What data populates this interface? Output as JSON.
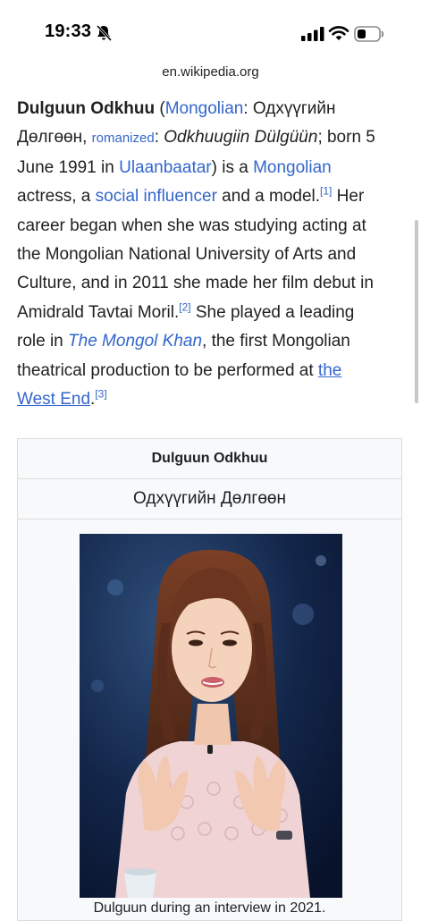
{
  "status_bar": {
    "time": "19:33",
    "icons": [
      "bell-slash-icon",
      "cellular-signal-icon",
      "wifi-icon",
      "battery-icon"
    ]
  },
  "browser": {
    "url": "en.wikipedia.org"
  },
  "article": {
    "subject": "Dulguun Odkhuu",
    "t1": " (",
    "link_mongolian_lang": "Mongolian",
    "t2": ": Одхүүгийн Дөлгөөн, ",
    "link_romanized": "romanized",
    "t3": ": ",
    "romanized_name": "Odkhuugiin Dülgüün",
    "t4": "; born 5 June 1991 in ",
    "link_city": "Ulaanbaatar",
    "t5": ") is a ",
    "link_nationality": "Mongolian",
    "t6": " actress, a ",
    "link_influencer": "social influencer",
    "t7": " and a model.",
    "ref1": "[1]",
    "t8": " Her career began when she was studying acting at the Mongolian National University of Arts and Culture, and in 2011 she made her film debut in Amidrald Tavtai Moril.",
    "ref2": "[2]",
    "t9": " She played a leading role in ",
    "link_film": "The Mongol Khan",
    "t10": ", the first Mongolian theatrical production to be performed at ",
    "link_theatre": "the West End",
    "t11": ".",
    "ref3": "[3]"
  },
  "infobox": {
    "title": "Dulguun Odkhuu",
    "native_name": "Одхүүгийн Дөлгөөн",
    "caption": "Dulguun during an interview in 2021."
  },
  "colors": {
    "link": "#3366cc",
    "text": "#202122",
    "infobox_bg": "#f8f9fa",
    "photo_bg": "#0e1b35"
  }
}
